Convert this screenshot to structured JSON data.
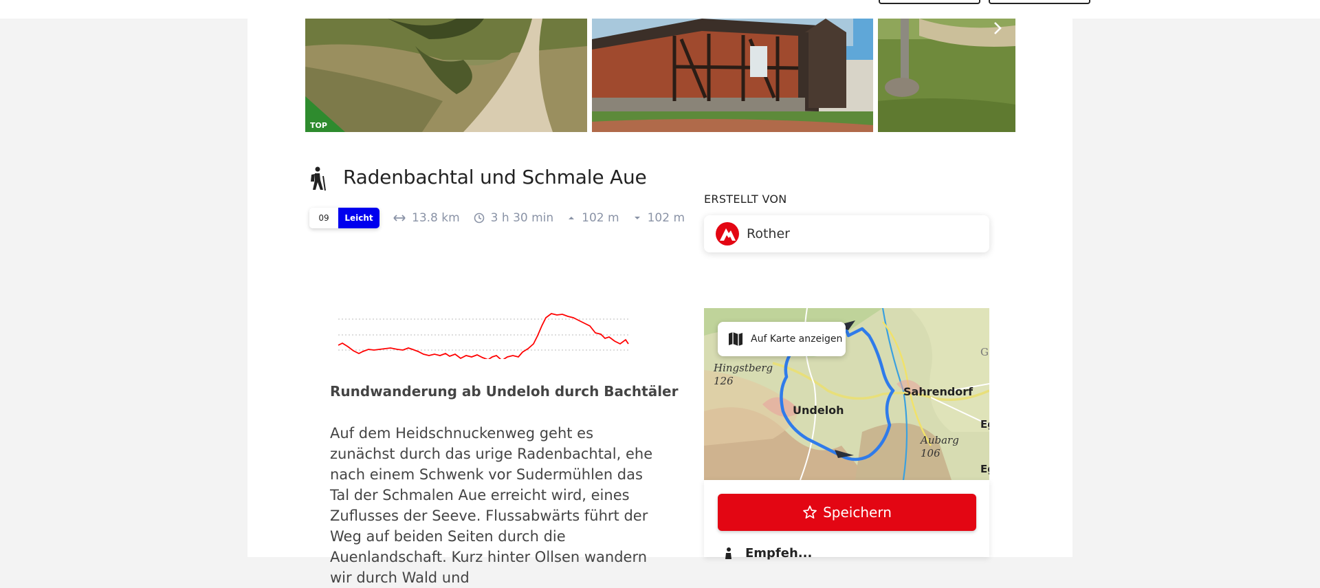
{
  "gallery": {
    "top_badge": "TOP",
    "next_label": "›"
  },
  "tour": {
    "title": "Radenbachtal und Schmale Aue",
    "difficulty_number": "09",
    "difficulty_label": "Leicht",
    "difficulty_color": "#0000ee",
    "distance": "13.8 km",
    "duration": "3 h 30 min",
    "ascent": "102 m",
    "descent": "102 m",
    "subtitle": "Rundwanderung ab Undeloh durch Bachtäler",
    "description": "Auf dem Heidschnuckenweg geht es zunächst durch das urige Radenbachtal, ehe nach einem Schwenk vor Sudermühlen das Tal der Schmalen Aue erreicht wird, eines Zuflusses der Seeve. Flussabwärts führt der Weg auf beiden Seiten durch die Auenlandschaft. Kurz hinter Ollsen wandern wir durch Wald und"
  },
  "author": {
    "created_by_label": "ERSTELLT VON",
    "name": "Rother",
    "brand_color": "#e30613"
  },
  "map": {
    "show_on_map_label": "Auf Karte anzeigen",
    "labels": {
      "hingstberg": "Hingstberg",
      "hingstberg_height": "126",
      "undeloh": "Undeloh",
      "sahrendorf": "Sahrendorf",
      "aubarg": "Aubarg",
      "aubarg_height": "106",
      "g": "G",
      "eg1": "Eg",
      "eg2": "Eg"
    },
    "route_color": "#2f7bea"
  },
  "actions": {
    "save_label": "Speichern",
    "save_color": "#e30613",
    "more_label": "Empfeh..."
  },
  "elevation_profile": {
    "line_color": "#ff0000",
    "grid": true
  }
}
